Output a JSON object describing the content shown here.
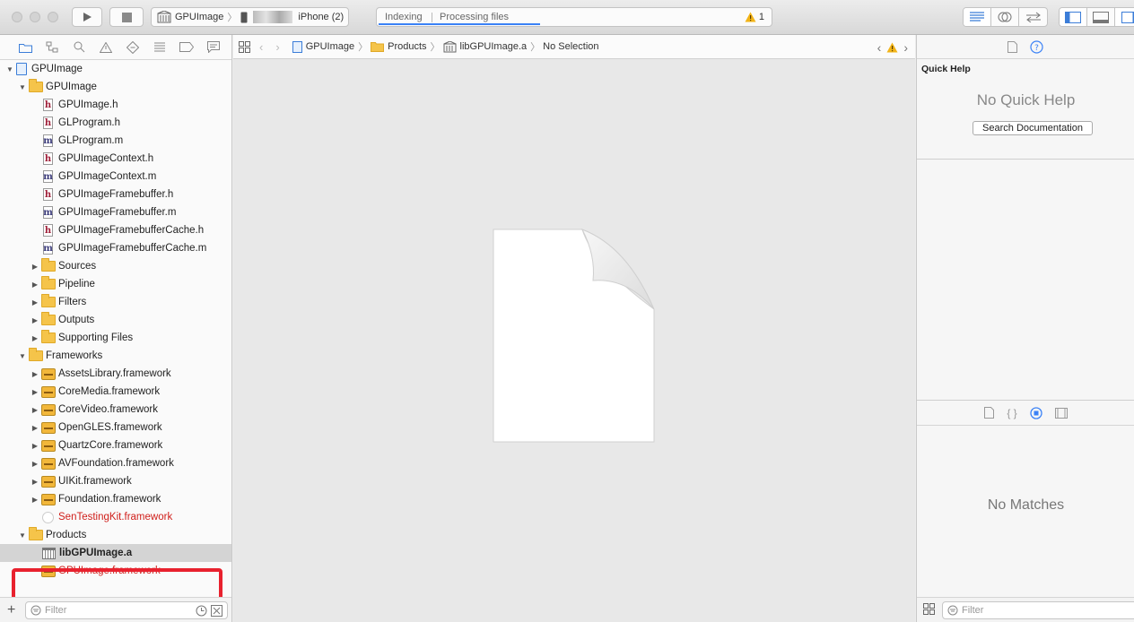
{
  "toolbar": {
    "scheme_target": "GPUImage",
    "device": "iPhone (2)",
    "activity_status": "Indexing",
    "activity_detail": "Processing files",
    "warning_count": "1"
  },
  "navigator": {
    "items": [
      {
        "label": "GPUImage",
        "kind": "project",
        "indent": 0,
        "disclosure": "open"
      },
      {
        "label": "GPUImage",
        "kind": "folder",
        "indent": 1,
        "disclosure": "open"
      },
      {
        "label": "GPUImage.h",
        "kind": "h",
        "indent": 2
      },
      {
        "label": "GLProgram.h",
        "kind": "h",
        "indent": 2
      },
      {
        "label": "GLProgram.m",
        "kind": "m",
        "indent": 2
      },
      {
        "label": "GPUImageContext.h",
        "kind": "h",
        "indent": 2
      },
      {
        "label": "GPUImageContext.m",
        "kind": "m",
        "indent": 2
      },
      {
        "label": "GPUImageFramebuffer.h",
        "kind": "h",
        "indent": 2
      },
      {
        "label": "GPUImageFramebuffer.m",
        "kind": "m",
        "indent": 2
      },
      {
        "label": "GPUImageFramebufferCache.h",
        "kind": "h",
        "indent": 2
      },
      {
        "label": "GPUImageFramebufferCache.m",
        "kind": "m",
        "indent": 2
      },
      {
        "label": "Sources",
        "kind": "folder",
        "indent": 2,
        "disclosure": "closed"
      },
      {
        "label": "Pipeline",
        "kind": "folder",
        "indent": 2,
        "disclosure": "closed"
      },
      {
        "label": "Filters",
        "kind": "folder",
        "indent": 2,
        "disclosure": "closed"
      },
      {
        "label": "Outputs",
        "kind": "folder",
        "indent": 2,
        "disclosure": "closed"
      },
      {
        "label": "Supporting Files",
        "kind": "folder",
        "indent": 2,
        "disclosure": "closed"
      },
      {
        "label": "Frameworks",
        "kind": "folder",
        "indent": 1,
        "disclosure": "open"
      },
      {
        "label": "AssetsLibrary.framework",
        "kind": "framework",
        "indent": 2,
        "disclosure": "closed"
      },
      {
        "label": "CoreMedia.framework",
        "kind": "framework",
        "indent": 2,
        "disclosure": "closed"
      },
      {
        "label": "CoreVideo.framework",
        "kind": "framework",
        "indent": 2,
        "disclosure": "closed"
      },
      {
        "label": "OpenGLES.framework",
        "kind": "framework",
        "indent": 2,
        "disclosure": "closed"
      },
      {
        "label": "QuartzCore.framework",
        "kind": "framework",
        "indent": 2,
        "disclosure": "closed"
      },
      {
        "label": "AVFoundation.framework",
        "kind": "framework",
        "indent": 2,
        "disclosure": "closed"
      },
      {
        "label": "UIKit.framework",
        "kind": "framework",
        "indent": 2,
        "disclosure": "closed"
      },
      {
        "label": "Foundation.framework",
        "kind": "framework",
        "indent": 2,
        "disclosure": "closed"
      },
      {
        "label": "SenTestingKit.framework",
        "kind": "missing",
        "indent": 2
      },
      {
        "label": "Products",
        "kind": "folder",
        "indent": 1,
        "disclosure": "open"
      },
      {
        "label": "libGPUImage.a",
        "kind": "library",
        "indent": 2,
        "selected": true
      },
      {
        "label": "GPUImage.framework",
        "kind": "framework-missing",
        "indent": 2
      }
    ],
    "filter_placeholder": "Filter"
  },
  "editor": {
    "breadcrumbs": [
      "GPUImage",
      "Products",
      "libGPUImage.a",
      "No Selection"
    ]
  },
  "inspector": {
    "quick_help_title": "Quick Help",
    "no_quick_help": "No Quick Help",
    "search_documentation": "Search Documentation",
    "no_matches": "No Matches",
    "filter_placeholder": "Filter"
  },
  "colors": {
    "missing_text": "#d0201c",
    "selection": "#d4d4d4",
    "highlight_box": "#e8212e",
    "accent": "#3b82f6"
  }
}
